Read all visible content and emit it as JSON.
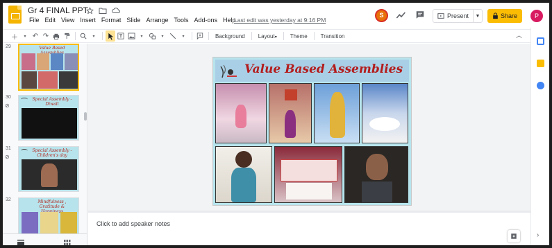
{
  "app": {
    "doc_title": "Gr 4 FINAL PPT",
    "menus": [
      "File",
      "Edit",
      "View",
      "Insert",
      "Format",
      "Slide",
      "Arrange",
      "Tools",
      "Add-ons",
      "Help"
    ],
    "last_edit": "Last edit was yesterday at 9:16 PM",
    "user_initial_s": "S",
    "user_initial_p": "P",
    "present_label": "Present",
    "share_label": "Share",
    "accent": "#fbbc04"
  },
  "toolbar": {
    "background": "Background",
    "layout": "Layout",
    "theme": "Theme",
    "transition": "Transition"
  },
  "filmstrip": {
    "slides": [
      {
        "number": "29",
        "title": "Value Based Assemblies"
      },
      {
        "number": "30",
        "title": "Special Assembly - Diwali"
      },
      {
        "number": "31",
        "title": "Special Assembly - Children's day"
      },
      {
        "number": "32",
        "title": "Mindfulness , Gratitude & Happiness"
      }
    ]
  },
  "slide": {
    "title": "Value Based Assemblies"
  },
  "notes": {
    "placeholder": "Click to add speaker notes"
  }
}
